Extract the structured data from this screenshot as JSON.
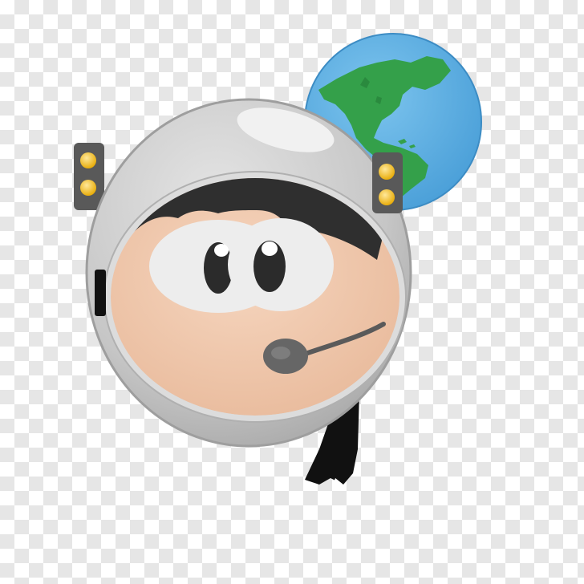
{
  "image": {
    "subject": "astronaut-emoji",
    "background": "transparency-checkerboard",
    "colors": {
      "checker_light": "#ffffff",
      "checker_dark": "#e6e6e6",
      "ocean": "#5aaee3",
      "land": "#34a04a",
      "helmet": "#c9c9c9",
      "skin": "#f0c9ad",
      "hair": "#2f2f2f",
      "light": "#f5c21e"
    }
  }
}
